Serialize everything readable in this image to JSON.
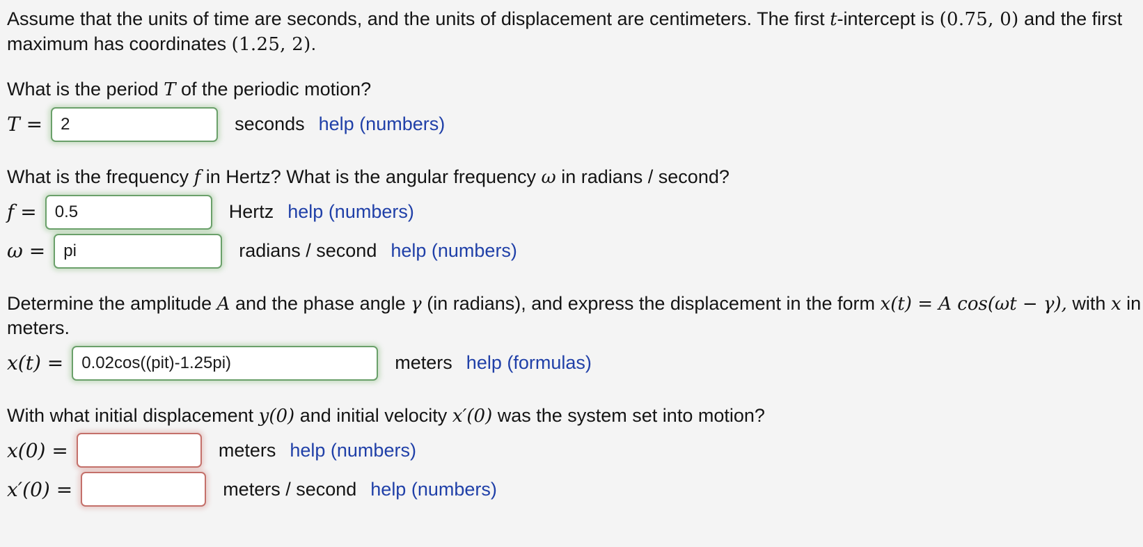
{
  "intro": {
    "text_part1": "Assume that the units of time are seconds, and the units of displacement are centimeters. The first ",
    "var_t": "t",
    "text_part2": "-intercept is ",
    "coord_intercept": "(0.75, 0)",
    "text_part3": " and the first maximum has coordinates ",
    "coord_max": "(1.25, 2)",
    "text_part4": "."
  },
  "q_period": {
    "prompt_part1": "What is the period ",
    "prompt_var": "T",
    "prompt_part2": " of the periodic motion?",
    "label_var": "T",
    "label_eq": "=",
    "input_value": "2",
    "input_placeholder": "",
    "unit": "seconds",
    "help_label": "help (numbers)",
    "state": "correct"
  },
  "q_frequency": {
    "prompt_part1": "What is the frequency ",
    "prompt_var_f": "f",
    "prompt_part2": " in Hertz? What is the angular frequency ",
    "prompt_var_omega": "ω",
    "prompt_part3": " in radians / second?",
    "rows": [
      {
        "label_var": "f",
        "label_eq": "=",
        "input_value": "0.5",
        "unit": "Hertz",
        "help_label": "help (numbers)",
        "state": "correct"
      },
      {
        "label_var": "ω",
        "label_eq": "=",
        "input_value": "pi",
        "unit": "radians / second",
        "help_label": "help (numbers)",
        "state": "correct"
      }
    ]
  },
  "q_amplitude": {
    "prompt_part1": "Determine the amplitude ",
    "prompt_var_A": "A",
    "prompt_part2": " and the phase angle ",
    "prompt_var_gamma": "γ",
    "prompt_part3": " (in radians), and express the displacement in the form ",
    "formula": "x(t) = A cos(ωt − γ),",
    "prompt_part4": " with ",
    "prompt_var_x": "x",
    "prompt_part5": " in meters.",
    "label_var": "x(t)",
    "label_eq": "=",
    "input_value": "0.02cos((pit)-1.25pi)",
    "unit": "meters",
    "help_label": "help (formulas)",
    "state": "correct"
  },
  "q_initial": {
    "prompt_part1": "With what initial displacement ",
    "prompt_var_y0": "y(0)",
    "prompt_part2": " and initial velocity ",
    "prompt_var_xp0": "x′(0)",
    "prompt_part3": " was the system set into motion?",
    "rows": [
      {
        "label_var": "x(0)",
        "label_eq": "=",
        "input_value": "",
        "unit": "meters",
        "help_label": "help (numbers)",
        "state": "incorrect"
      },
      {
        "label_var": "x′(0)",
        "label_eq": "=",
        "input_value": "",
        "unit": "meters / second",
        "help_label": "help (numbers)",
        "state": "incorrect"
      }
    ]
  },
  "colors": {
    "page_background": "#f4f4f4",
    "text": "#141414",
    "link": "#2040a8",
    "input_correct_border": "#6aa06a",
    "input_incorrect_border": "#c4706a",
    "input_background": "#ffffff"
  }
}
